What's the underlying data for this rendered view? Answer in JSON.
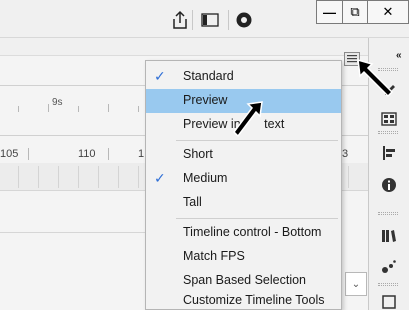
{
  "window_buttons": {
    "minimize": "—",
    "restore": "⧉",
    "close": "✕"
  },
  "ruler": {
    "label_9s": "9s",
    "frames": [
      "105",
      "110",
      "1",
      "3"
    ]
  },
  "menu": {
    "items": [
      {
        "label": "Standard",
        "checked": true,
        "highlighted": false
      },
      {
        "label": "Preview",
        "checked": false,
        "highlighted": true
      },
      {
        "label": "Preview in Context",
        "display": "Preview in ",
        "display_tail": "text",
        "checked": false,
        "highlighted": false
      },
      {
        "label": "Short",
        "checked": false,
        "highlighted": false
      },
      {
        "label": "Medium",
        "checked": true,
        "highlighted": false
      },
      {
        "label": "Tall",
        "checked": false,
        "highlighted": false
      },
      {
        "label": "Timeline control - Bottom",
        "checked": false,
        "highlighted": false
      },
      {
        "label": "Match FPS",
        "checked": false,
        "highlighted": false
      },
      {
        "label": "Span Based Selection",
        "checked": false,
        "highlighted": false
      },
      {
        "label": "Customize Timeline Tools",
        "checked": false,
        "highlighted": false
      }
    ]
  },
  "icons": {
    "share": "share-icon",
    "panel": "panel-toggle-icon",
    "record": "record-icon",
    "menu": "panel-menu-icon",
    "collapse": "collapse-icon"
  },
  "colors": {
    "highlight": "#99c9ef",
    "check": "#2f6fd6",
    "cursor": "#000000"
  }
}
